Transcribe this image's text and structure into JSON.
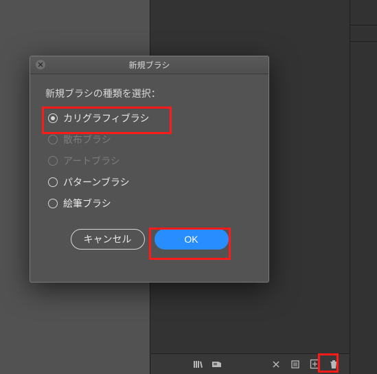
{
  "dialog": {
    "title": "新規ブラシ",
    "prompt": "新規ブラシの種類を選択：",
    "options": {
      "calligraphic": "カリグラフィブラシ",
      "scatter": "散布ブラシ",
      "art": "アートブラシ",
      "pattern": "パターンブラシ",
      "bristle": "絵筆ブラシ"
    },
    "buttons": {
      "cancel": "キャンセル",
      "ok": "OK"
    }
  }
}
